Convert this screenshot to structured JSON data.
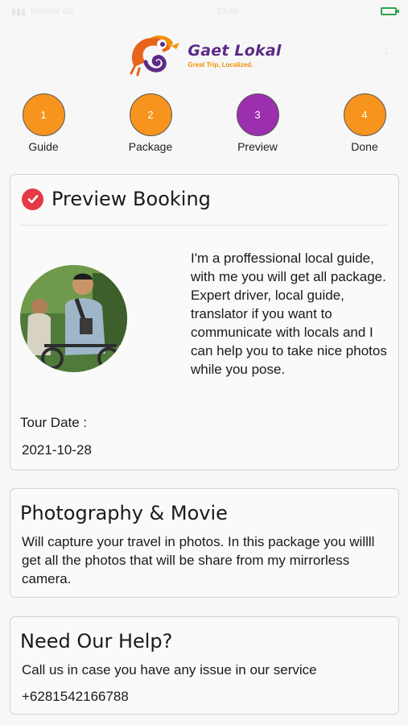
{
  "status": {
    "left": "Indosat 4G",
    "time": "10.48"
  },
  "app": {
    "name": "Gaet Lokal",
    "tagline": "Great Trip, Localized."
  },
  "colors": {
    "orange": "#f7941d",
    "purple": "#9b2fae",
    "red": "#e63946"
  },
  "steps": [
    {
      "number": "1",
      "label": "Guide",
      "color": "#f7941d"
    },
    {
      "number": "2",
      "label": "Package",
      "color": "#f7941d"
    },
    {
      "number": "3",
      "label": "Preview",
      "color": "#9b2fae"
    },
    {
      "number": "4",
      "label": "Done",
      "color": "#f7941d"
    }
  ],
  "preview": {
    "title": "Preview Booking",
    "guide_description": "I'm a proffessional local guide, with me you will get all package. Expert driver, local guide, translator if you want to communicate with locals and I can help you to take nice photos while you pose.",
    "tour_date_label": "Tour Date :",
    "tour_date": "2021-10-28"
  },
  "package": {
    "title": "Photography & Movie",
    "description": "Will capture your travel in photos. In this package you willll get all the photos that will be share from my mirrorless camera."
  },
  "help": {
    "title": "Need Our Help?",
    "description": "Call us in case you have any issue in our service",
    "phone": "+6281542166788"
  }
}
